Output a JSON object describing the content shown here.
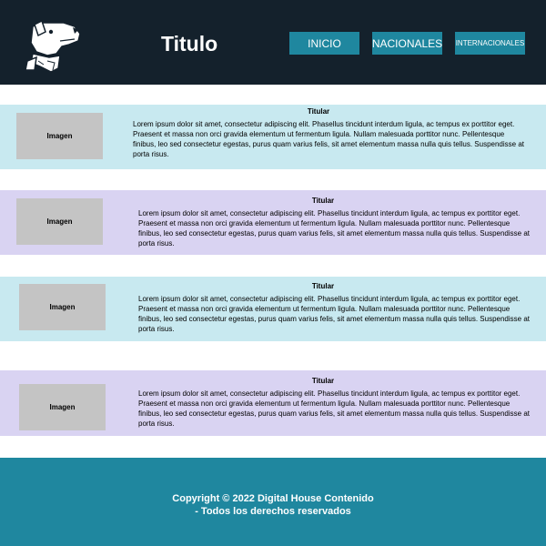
{
  "header": {
    "logo_icon": "dog-with-bandana-logo-icon",
    "title": "Titulo",
    "nav": [
      {
        "label": "INICIO"
      },
      {
        "label": "NACIONALES"
      },
      {
        "label": "INTERNACIONALES"
      }
    ]
  },
  "articles": [
    {
      "image_label": "Imagen",
      "title": "Titular",
      "body": "Lorem ipsum dolor sit amet, consectetur adipiscing elit. Phasellus tincidunt interdum ligula, ac tempus ex porttitor eget. Praesent et massa non orci gravida elementum ut fermentum ligula. Nullam malesuada porttitor nunc. Pellentesque finibus, leo sed consectetur egestas, purus quam varius felis, sit amet elementum massa nulla quis tellus. Suspendisse at porta risus."
    },
    {
      "image_label": "Imagen",
      "title": "Titular",
      "body": "Lorem ipsum dolor sit amet, consectetur adipiscing elit. Phasellus tincidunt interdum ligula, ac tempus ex porttitor eget. Praesent et massa non orci gravida elementum ut fermentum ligula. Nullam malesuada porttitor nunc. Pellentesque finibus, leo sed consectetur egestas, purus quam varius felis, sit amet elementum massa nulla quis tellus. Suspendisse at porta risus."
    },
    {
      "image_label": "Imagen",
      "title": "Titular",
      "body": "Lorem ipsum dolor sit amet, consectetur adipiscing elit. Phasellus tincidunt interdum ligula, ac tempus ex porttitor eget. Praesent et massa non orci gravida elementum ut fermentum ligula. Nullam malesuada porttitor nunc. Pellentesque finibus, leo sed consectetur egestas, purus quam varius felis, sit amet elementum massa nulla quis tellus. Suspendisse at porta risus."
    },
    {
      "image_label": "Imagen",
      "title": "Titular",
      "body": "Lorem ipsum dolor sit amet, consectetur adipiscing elit. Phasellus tincidunt interdum ligula, ac tempus ex porttitor eget. Praesent et massa non orci gravida elementum ut fermentum ligula. Nullam malesuada porttitor nunc. Pellentesque finibus, leo sed consectetur egestas, purus quam varius felis, sit amet elementum massa nulla quis tellus. Suspendisse at porta risus."
    }
  ],
  "footer": {
    "line1": "Copyright © 2022 Digital House Contenido",
    "line2": "- Todos los derechos reservados"
  },
  "colors": {
    "header_bg": "#14212c",
    "accent": "#1f879f",
    "article_blue": "#c8e9f0",
    "article_lavender": "#d9d3f2",
    "image_placeholder": "#c4c4c4"
  }
}
